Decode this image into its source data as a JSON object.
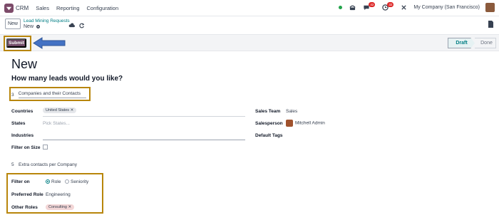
{
  "navbar": {
    "app_name": "CRM",
    "menu": [
      "Sales",
      "Reporting",
      "Configuration"
    ],
    "messages_count": "42",
    "activities_count": "32",
    "company": "My Company (San Francisco)"
  },
  "control": {
    "new_label": "New",
    "breadcrumb_parent": "Lead Mining Requests",
    "breadcrumb_current": "New"
  },
  "statusbar": {
    "submit_label": "Submit",
    "stages": [
      "Draft",
      "Done"
    ],
    "active_stage": "Draft"
  },
  "form": {
    "title": "New",
    "question": "How many leads would you like?",
    "lead_count": "3",
    "target": "Companies and their Contacts",
    "countries_label": "Countries",
    "countries_tag": "United States",
    "states_label": "States",
    "states_placeholder": "Pick States...",
    "industries_label": "Industries",
    "filter_size_label": "Filter on Size",
    "sales_team_label": "Sales Team",
    "sales_team_value": "Sales",
    "salesperson_label": "Salesperson",
    "salesperson_value": "Mitchell Admin",
    "default_tags_label": "Default Tags",
    "extra_contacts_count": "5",
    "extra_contacts_text": "Extra contacts per Company",
    "filter_on_label": "Filter on",
    "filter_on_options": [
      "Role",
      "Seniority"
    ],
    "filter_on_selected": "Role",
    "preferred_role_label": "Preferred Role",
    "preferred_role_value": "Engineering",
    "other_roles_label": "Other Roles",
    "other_roles_tag": "Consulting"
  },
  "colors": {
    "brand": "#714b67",
    "accent": "#017e84",
    "highlight": "#b8860b",
    "arrow": "#4472c4"
  }
}
